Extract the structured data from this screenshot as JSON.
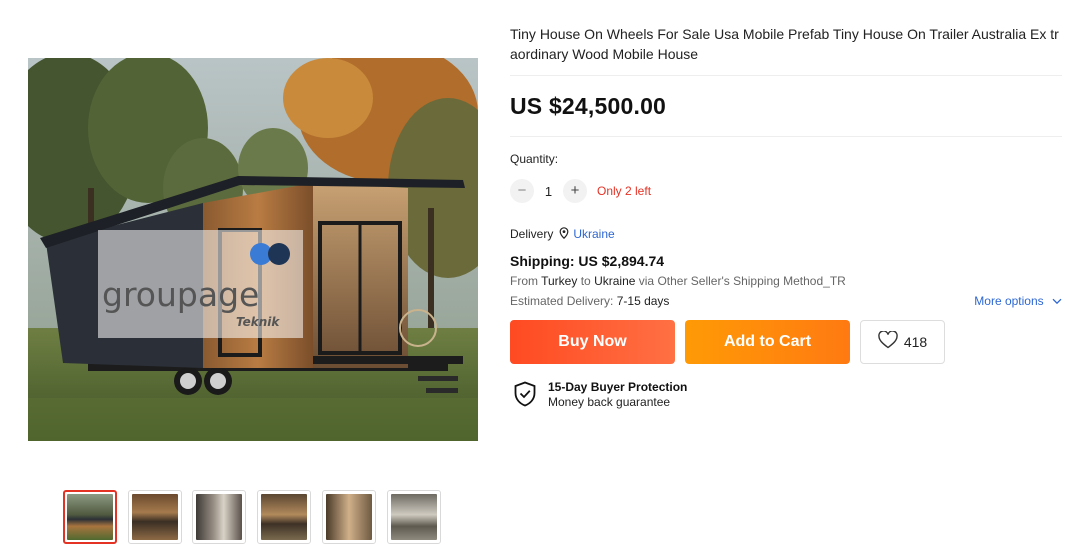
{
  "product": {
    "title": "Tiny House On Wheels For Sale Usa Mobile Prefab Tiny House On Trailer Australia Ex traordinary Wood Mobile House",
    "price": "US $24,500.00",
    "watermark": "groupage",
    "watermark_sub": "Teknik"
  },
  "quantity": {
    "label": "Quantity:",
    "minus": "−",
    "value": "1",
    "plus": "+",
    "stock": "Only 2 left"
  },
  "delivery": {
    "label": "Delivery",
    "country": "Ukraine"
  },
  "shipping": {
    "title": "Shipping: US $2,894.74",
    "from_prefix": "From",
    "from_country": "Turkey",
    "to_word": "to",
    "to_country": "Ukraine",
    "via_text": "via Other Seller's Shipping Method_TR",
    "estimated_label": "Estimated Delivery:",
    "estimated_value": "7-15 days",
    "more_options": "More options"
  },
  "actions": {
    "buy_now": "Buy Now",
    "add_to_cart": "Add to Cart",
    "wishlist_count": "418"
  },
  "protection": {
    "title": "15-Day Buyer Protection",
    "subtitle": "Money back guarantee"
  },
  "colors": {
    "accent_red": "#e43225",
    "buy_now": "#ff4a22",
    "add_to_cart": "#ff9a05",
    "link_blue": "#2d67d3"
  },
  "thumbnails": [
    {
      "name": "thumb-1",
      "active": true
    },
    {
      "name": "thumb-2",
      "active": false
    },
    {
      "name": "thumb-3",
      "active": false
    },
    {
      "name": "thumb-4",
      "active": false
    },
    {
      "name": "thumb-5",
      "active": false
    },
    {
      "name": "thumb-6",
      "active": false
    }
  ]
}
